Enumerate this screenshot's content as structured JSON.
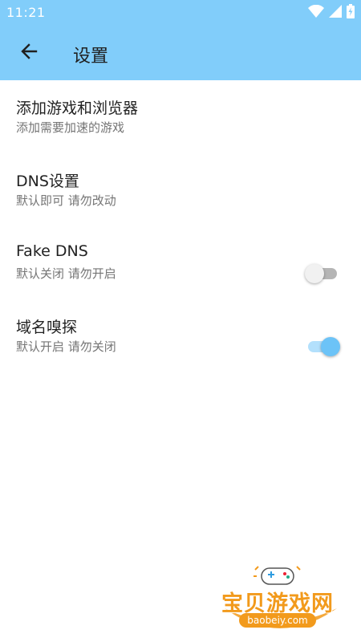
{
  "status_bar": {
    "time": "11:21",
    "icons": [
      "wifi-icon",
      "signal-icon",
      "battery-icon"
    ],
    "color": "#81cdfa"
  },
  "app_bar": {
    "title": "设置",
    "back_icon": "back-arrow-icon"
  },
  "settings": [
    {
      "title": "添加游戏和浏览器",
      "subtitle": "添加需要加速的游戏"
    },
    {
      "title": "DNS设置",
      "subtitle": "默认即可 请勿改动"
    },
    {
      "title": "Fake DNS",
      "subtitle": "默认关闭 请勿开启",
      "toggle": false
    },
    {
      "title": "域名嗅探",
      "subtitle": "默认开启 请勿关闭",
      "toggle": true
    }
  ],
  "watermark": {
    "name": "宝贝游戏网",
    "url": "baobeiy.com"
  },
  "colors": {
    "accent": "#81cdfa",
    "switch_on": "#6cc3f7",
    "switch_off": "#b5b5b5",
    "watermark": "#f29a1c"
  }
}
